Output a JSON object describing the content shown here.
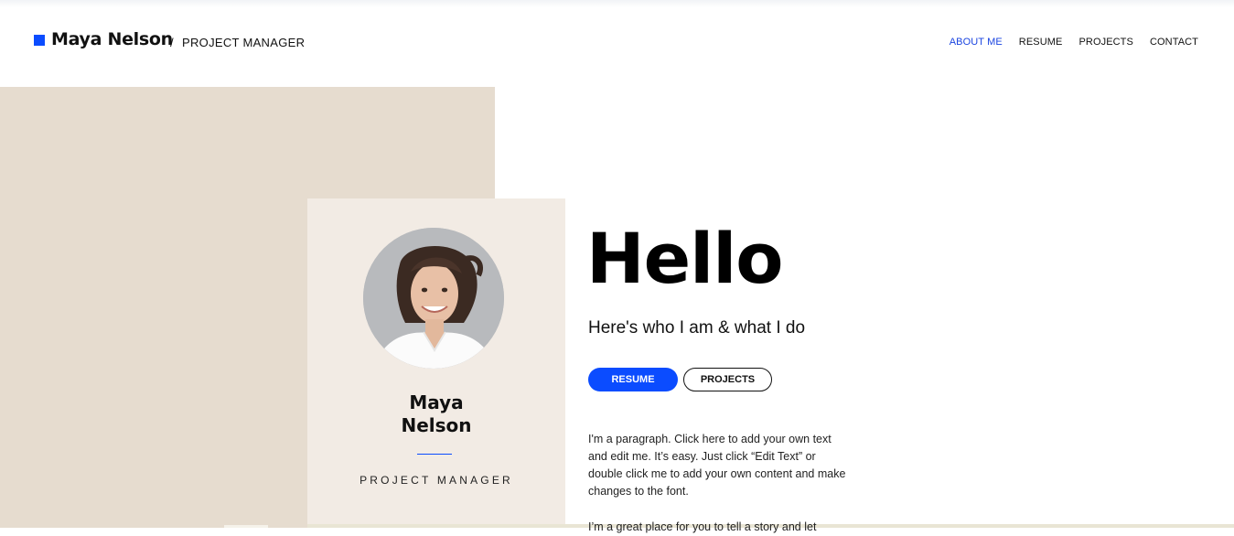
{
  "colors": {
    "accent": "#0b4cff",
    "beige_block": "#e6dccf",
    "card_bg": "#f2ebe4"
  },
  "header": {
    "name": "Maya Nelson",
    "separator": "/",
    "role": "PROJECT MANAGER"
  },
  "nav": {
    "items": [
      {
        "label": "ABOUT ME",
        "active": true
      },
      {
        "label": "RESUME"
      },
      {
        "label": "PROJECTS"
      },
      {
        "label": "CONTACT"
      }
    ]
  },
  "card": {
    "first_name": "Maya",
    "last_name": "Nelson",
    "role": "PROJECT MANAGER"
  },
  "hero": {
    "greeting": "Hello",
    "subtitle": "Here's who I am & what I do",
    "resume_button": "RESUME",
    "projects_button": "PROJECTS",
    "paragraph": "I'm a paragraph. Click here to add your own text and edit me. It’s easy. Just click “Edit Text” or double click me to add your own content and make changes to the font.",
    "paragraph_2_partial": "I’m a great place for you to tell a story and let"
  }
}
